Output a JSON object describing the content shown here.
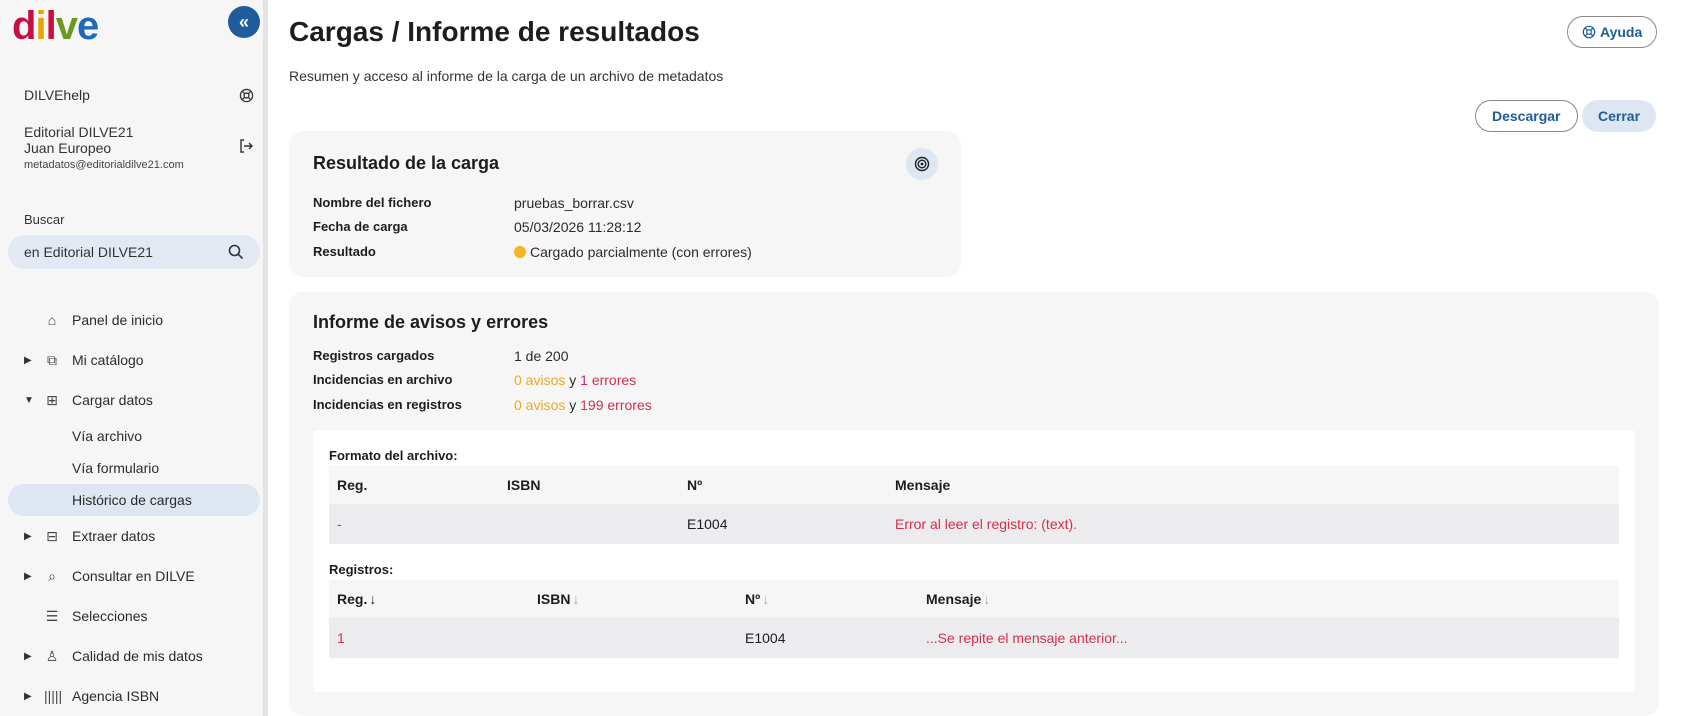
{
  "sidebar": {
    "logo": {
      "l1": "d",
      "l2": "i",
      "l3": "l",
      "l4": "v",
      "l5": "e"
    },
    "collapse_icon": "double-chevron-left-icon",
    "help_label": "DILVEhelp",
    "org": "Editorial DILVE21",
    "user": "Juan Europeo",
    "email": "metadatos@editorialdilve21.com",
    "search_label": "Buscar",
    "search_value": "en Editorial DILVE21",
    "nav": {
      "inicio": "Panel de inicio",
      "catalogo": "Mi catálogo",
      "cargar": "Cargar datos",
      "via_archivo": "Vía archivo",
      "via_formulario": "Vía formulario",
      "historico": "Histórico de cargas",
      "extraer": "Extraer datos",
      "consultar": "Consultar en DILVE",
      "selecciones": "Selecciones",
      "calidad": "Calidad de mis datos",
      "agencia": "Agencia ISBN"
    }
  },
  "header": {
    "title": "Cargas / Informe de resultados",
    "subtitle": "Resumen y acceso al informe de la carga de un archivo de metadatos",
    "help_button": "Ayuda",
    "download_button": "Descargar",
    "close_button": "Cerrar"
  },
  "result": {
    "title": "Resultado de la carga",
    "file_label": "Nombre del fichero",
    "file_value": "pruebas_borrar.csv",
    "date_label": "Fecha de carga",
    "date_value": "05/03/2026 11:28:12",
    "result_label": "Resultado",
    "result_value": "Cargado parcialmente (con errores)",
    "status_color": "#f5b51f"
  },
  "report": {
    "title": "Informe de avisos y errores",
    "loaded_label": "Registros cargados",
    "loaded_value": "1 de 200",
    "file_issues_label": "Incidencias en archivo",
    "file_warnings": "0 avisos",
    "file_y": "y",
    "file_errors": "1 errores",
    "rec_issues_label": "Incidencias en registros",
    "rec_warnings": "0 avisos",
    "rec_y": "y",
    "rec_errors": "199 errores",
    "format_section": "Formato del archivo:",
    "format_headers": {
      "reg": "Reg.",
      "isbn": "ISBN",
      "num": "Nº",
      "msg": "Mensaje"
    },
    "format_row": {
      "reg": "-",
      "isbn": "",
      "num": "E1004",
      "msg": "Error al leer el registro: (text)."
    },
    "records_section": "Registros:",
    "records_headers": {
      "reg": "Reg.",
      "isbn": "ISBN",
      "num": "Nº",
      "msg": "Mensaje"
    },
    "records_row": {
      "reg": "1",
      "isbn": "",
      "num": "E1004",
      "msg": "...Se repite el mensaje anterior..."
    }
  },
  "colors": {
    "accent": "#1d5d9b",
    "warning": "#f0a71b",
    "error": "#d22f4b"
  }
}
